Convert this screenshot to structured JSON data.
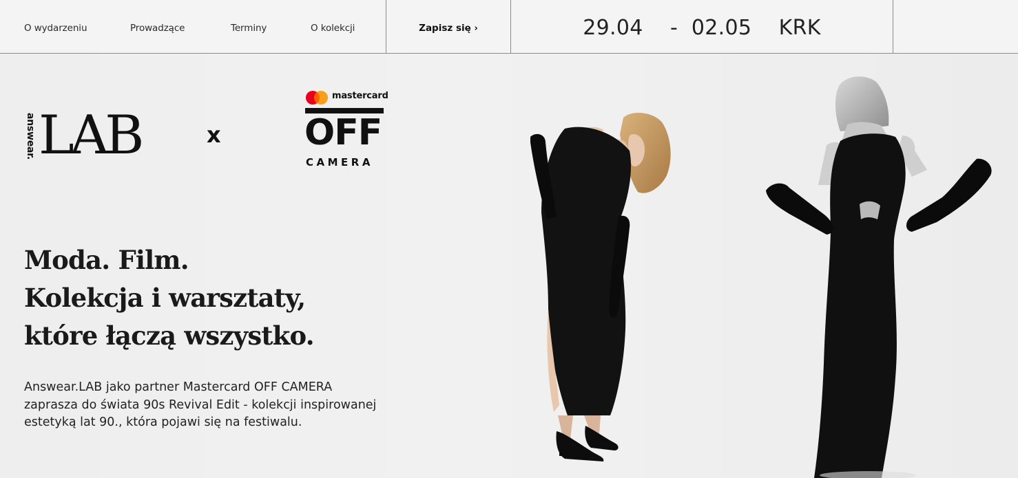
{
  "nav": {
    "links": [
      {
        "label": "O wydarzeniu"
      },
      {
        "label": "Prowadzące"
      },
      {
        "label": "Terminy"
      },
      {
        "label": "O kolekcji"
      }
    ],
    "cta_label": "Zapisz się",
    "cta_icon": "chevron-right-icon",
    "date_start": "29.04",
    "date_sep": "- ",
    "date_end": "02.05",
    "city": "KRK"
  },
  "logos": {
    "lab_brand": "answear.",
    "lab_word": "LAB",
    "collab_mark": "x",
    "mastercard_word": "mastercard",
    "off_word": "OFF",
    "camera_word": "CAMERA"
  },
  "hero": {
    "headline_lines": [
      "Moda. Film.",
      "Kolekcja i warsztaty,",
      "które łączą wszystko."
    ],
    "intro_lines": [
      "Answear.LAB jako partner Mastercard OFF CAMERA",
      "zaprasza do świata 90s Revival Edit - kolekcji inspirowanej",
      "estetyką lat 90., która pojawi się na festiwalu."
    ]
  },
  "colors": {
    "background": "#f0f0f0",
    "text": "#111111",
    "divider": "#8a8a8a",
    "mastercard_red": "#eb001b",
    "mastercard_orange": "#f79e1b"
  }
}
